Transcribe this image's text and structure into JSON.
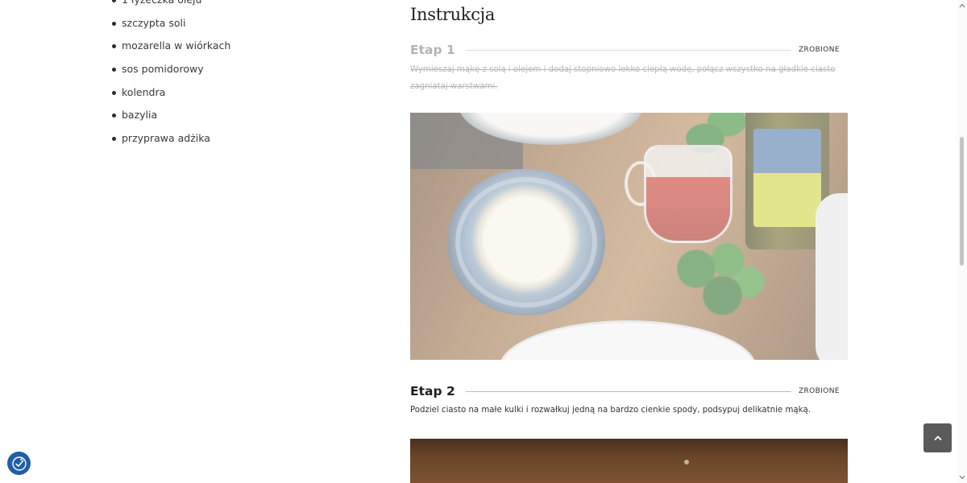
{
  "ingredients": {
    "items": [
      "1 łyżeczka oleju",
      "szczypta soli",
      "mozarella w wiórkach",
      "sos pomidorowy",
      "kolendra",
      "bazylia",
      "przyprawa adżika"
    ]
  },
  "instructions": {
    "title": "Instrukcja",
    "steps": [
      {
        "label": "Etap 1",
        "status": "ZROBIONE",
        "text": "Wymieszaj mąkę z solą i olejem i dodaj stopniowo lekko ciepłą wodę, połącz wszystko na gładkie ciasto zagniataj warstwami.",
        "done": true
      },
      {
        "label": "Etap 2",
        "status": "ZROBIONE",
        "text": "Podziel ciasto na małe kulki i rozwałkuj jedną na bardzo cienkie spody, podsypuj delikatnie mąką.",
        "done": false
      }
    ]
  },
  "controls": {
    "scroll_top_icon": "chevron-up-icon",
    "accessibility_icon": "accessibility-icon"
  },
  "colors": {
    "accessibility_button": "#1f5fa6",
    "scroll_top_button": "#5a5a5a"
  }
}
